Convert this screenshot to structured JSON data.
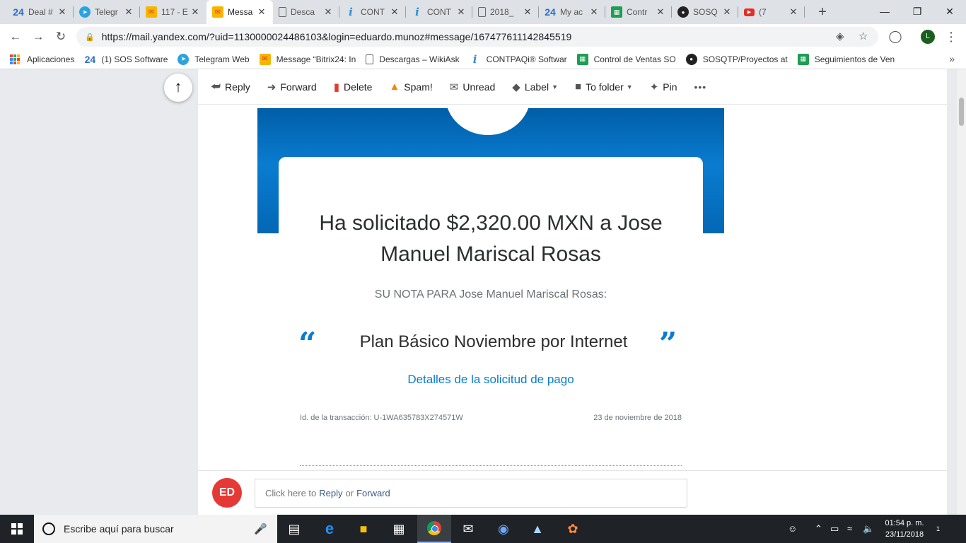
{
  "browser": {
    "tabs": [
      {
        "favicon": "fav-24",
        "favicon_text": "24",
        "title": "Deal #"
      },
      {
        "favicon": "fav-tg",
        "favicon_text": "➤",
        "title": "Telegr"
      },
      {
        "favicon": "fav-mail",
        "favicon_text": "✉",
        "title": "117 - E"
      },
      {
        "favicon": "fav-mail",
        "favicon_text": "✉",
        "title": "Messa"
      },
      {
        "favicon": "fav-doc",
        "favicon_text": "",
        "title": "Desca"
      },
      {
        "favicon": "fav-i",
        "favicon_text": "i",
        "title": "CONT"
      },
      {
        "favicon": "fav-i",
        "favicon_text": "i",
        "title": "CONT"
      },
      {
        "favicon": "fav-doc",
        "favicon_text": "",
        "title": "2018_"
      },
      {
        "favicon": "fav-24",
        "favicon_text": "24",
        "title": "My ac"
      },
      {
        "favicon": "fav-sheet",
        "favicon_text": "▦",
        "title": "Contr"
      },
      {
        "favicon": "fav-gh",
        "favicon_text": "●",
        "title": "SOSQ"
      },
      {
        "favicon": "fav-yt",
        "favicon_text": "▶",
        "title": "(7"
      }
    ],
    "active_tab_index": 3,
    "tab_close_glyph": "✕",
    "new_tab_glyph": "+",
    "url": "https://mail.yandex.com/?uid=1130000024486103&login=eduardo.munoz#message/167477611142845519",
    "profile_initial": "L",
    "bookmarks": [
      {
        "icon": "apps-icon",
        "label": "Aplicaciones"
      },
      {
        "icon": "bitrix-icon",
        "favicon": "fav-24",
        "favicon_text": "24",
        "label": "(1) SOS Software"
      },
      {
        "icon": "telegram-icon",
        "favicon": "fav-tg",
        "favicon_text": "➤",
        "label": "Telegram Web"
      },
      {
        "icon": "mail-icon",
        "favicon": "fav-mail",
        "favicon_text": "✉",
        "label": "Message “Bitrix24: In"
      },
      {
        "icon": "document-icon",
        "favicon": "fav-doc",
        "favicon_text": "",
        "label": "Descargas – WikiAsk"
      },
      {
        "icon": "contpaqi-icon",
        "favicon": "fav-i",
        "favicon_text": "i",
        "label": "CONTPAQi® Softwar"
      },
      {
        "icon": "sheet-icon",
        "favicon": "fav-sheet",
        "favicon_text": "▦",
        "label": "Control de Ventas SO"
      },
      {
        "icon": "github-icon",
        "favicon": "fav-gh",
        "favicon_text": "●",
        "label": "SOSQTP/Proyectos at"
      },
      {
        "icon": "sheet-icon",
        "favicon": "fav-sheet",
        "favicon_text": "▦",
        "label": "Seguimientos de Ven"
      }
    ]
  },
  "mail_toolbar": {
    "reply": "Reply",
    "forward": "Forward",
    "delete": "Delete",
    "spam": "Spam!",
    "unread": "Unread",
    "label": "Label",
    "to_folder": "To folder",
    "pin": "Pin",
    "more": "•••"
  },
  "email": {
    "title": "Ha solicitado $2,320.00 MXN a Jose Manuel Mariscal Rosas",
    "note_heading": "SU NOTA PARA Jose Manuel Mariscal Rosas:",
    "note": "Plan Básico Noviembre por Internet",
    "quote_open": "“",
    "quote_close": "”",
    "details_link": "Detalles de la solicitud de pago",
    "transaction_id": "Id. de la transacción: U-1WA635783X274571W",
    "date": "23 de noviembre de 2018"
  },
  "reply_bar": {
    "avatar_initials": "ED",
    "prefix": "Click here to",
    "reply": "Reply",
    "or": "or",
    "forward": "Forward"
  },
  "taskbar": {
    "search_placeholder": "Escribe aquí para buscar",
    "time": "01:54 p. m.",
    "date": "23/11/2018",
    "notification_count": "1"
  }
}
